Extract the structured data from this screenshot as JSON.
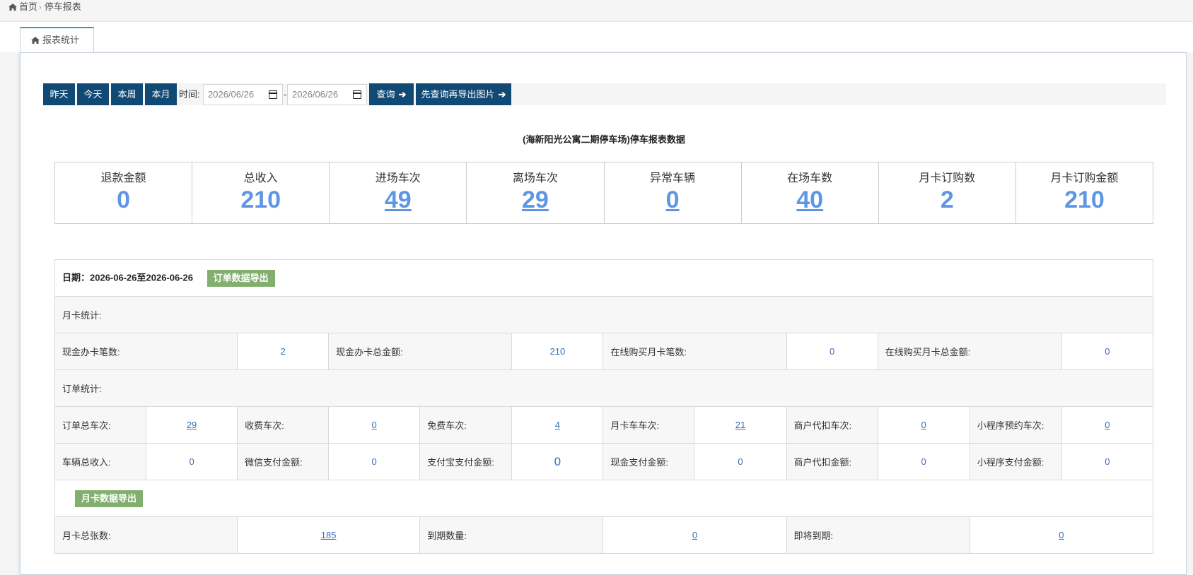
{
  "breadcrumb": {
    "home": "首页",
    "current": "停车报表"
  },
  "tab": {
    "label": "报表统计"
  },
  "toolbar": {
    "yesterday": "昨天",
    "today": "今天",
    "this_week": "本周",
    "this_month": "本月",
    "time_label": "时间:",
    "start_date": "2026/06/26",
    "dash": "-",
    "end_date": "2026/06/26",
    "query": "查询",
    "query_export": "先查询再导出图片"
  },
  "report_title": "(海新阳光公寓二期停车场)停车报表数据",
  "stats": [
    {
      "label": "退款金额",
      "value": "0"
    },
    {
      "label": "总收入",
      "value": "210"
    },
    {
      "label": "进场车次",
      "value": "49"
    },
    {
      "label": "离场车次",
      "value": "29"
    },
    {
      "label": "异常车辆",
      "value": "0"
    },
    {
      "label": "在场车数",
      "value": "40"
    },
    {
      "label": "月卡订购数",
      "value": "2"
    },
    {
      "label": "月卡订购金额",
      "value": "210"
    }
  ],
  "detail": {
    "date_text": "日期：2026-06-26至2026-06-26",
    "order_export": "订单数据导出",
    "monthly_section": "月卡统计:",
    "monthly": [
      {
        "label": "现金办卡笔数:",
        "value": "2"
      },
      {
        "label": "现金办卡总金额:",
        "value": "210"
      },
      {
        "label": "在线购买月卡笔数:",
        "value": "0"
      },
      {
        "label": "在线购买月卡总金额:",
        "value": "0"
      }
    ],
    "order_section": "订单统计:",
    "orders_row1": [
      {
        "label": "订单总车次:",
        "value": "29"
      },
      {
        "label": "收费车次:",
        "value": "0"
      },
      {
        "label": "免费车次:",
        "value": "4"
      },
      {
        "label": "月卡车车次:",
        "value": "21"
      },
      {
        "label": "商户代扣车次:",
        "value": "0"
      },
      {
        "label": "小程序预约车次:",
        "value": "0"
      }
    ],
    "orders_row2": [
      {
        "label": "车辆总收入:",
        "value": "0"
      },
      {
        "label": "微信支付金额:",
        "value": "0"
      },
      {
        "label": "支付宝支付金额:",
        "value": "0"
      },
      {
        "label": "现金支付金额:",
        "value": "0"
      },
      {
        "label": "商户代扣金额:",
        "value": "0"
      },
      {
        "label": "小程序支付金额:",
        "value": "0"
      }
    ],
    "monthcard_export": "月卡数据导出",
    "monthcard": [
      {
        "label": "月卡总张数:",
        "value": "185"
      },
      {
        "label": "到期数量:",
        "value": "0"
      },
      {
        "label": "即将到期:",
        "value": "0"
      }
    ]
  }
}
